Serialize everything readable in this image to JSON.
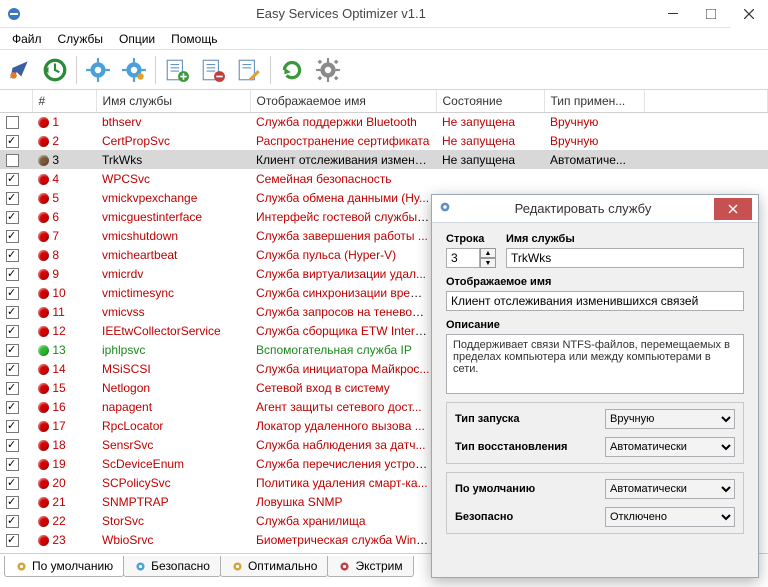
{
  "window": {
    "title": "Easy Services Optimizer v1.1"
  },
  "menu": {
    "file": "Файл",
    "services": "Службы",
    "options": "Опции",
    "help": "Помощь"
  },
  "columns": {
    "num": "#",
    "name": "Имя службы",
    "display": "Отображаемое имя",
    "state": "Состояние",
    "start": "Тип примен..."
  },
  "state": {
    "stopped": "Не запущена"
  },
  "start": {
    "manual": "Вручную",
    "auto": "Автоматиче..."
  },
  "rows": [
    {
      "n": "1",
      "chk": false,
      "dot": "red",
      "name": "bthserv",
      "disp": "Служба поддержки Bluetooth",
      "state": "stopped",
      "st": "manual",
      "cls": "redt"
    },
    {
      "n": "2",
      "chk": true,
      "dot": "red",
      "name": "CertPropSvc",
      "disp": "Распространение сертификата",
      "state": "stopped",
      "st": "manual",
      "cls": "redt"
    },
    {
      "n": "3",
      "chk": false,
      "dot": "brown",
      "name": "TrkWks",
      "disp": "Клиент отслеживания изменив...",
      "state": "stopped",
      "st": "auto",
      "cls": "blackt",
      "sel": true
    },
    {
      "n": "4",
      "chk": true,
      "dot": "red",
      "name": "WPCSvc",
      "disp": "Семейная безопасность",
      "state": "",
      "st": "",
      "cls": "redt"
    },
    {
      "n": "5",
      "chk": true,
      "dot": "red",
      "name": "vmickvpexchange",
      "disp": "Служба обмена данными (Hy...",
      "state": "",
      "st": "",
      "cls": "redt"
    },
    {
      "n": "6",
      "chk": true,
      "dot": "red",
      "name": "vmicguestinterface",
      "disp": "Интерфейс гостевой службы ...",
      "state": "",
      "st": "",
      "cls": "redt"
    },
    {
      "n": "7",
      "chk": true,
      "dot": "red",
      "name": "vmicshutdown",
      "disp": "Служба завершения работы ...",
      "state": "",
      "st": "",
      "cls": "redt"
    },
    {
      "n": "8",
      "chk": true,
      "dot": "red",
      "name": "vmicheartbeat",
      "disp": "Служба пульса (Hyper-V)",
      "state": "",
      "st": "",
      "cls": "redt"
    },
    {
      "n": "9",
      "chk": true,
      "dot": "red",
      "name": "vmicrdv",
      "disp": "Служба виртуализации удал...",
      "state": "",
      "st": "",
      "cls": "redt"
    },
    {
      "n": "10",
      "chk": true,
      "dot": "red",
      "name": "vmictimesync",
      "disp": "Служба синхронизации време...",
      "state": "",
      "st": "",
      "cls": "redt"
    },
    {
      "n": "11",
      "chk": true,
      "dot": "red",
      "name": "vmicvss",
      "disp": "Служба запросов на теневое ...",
      "state": "",
      "st": "",
      "cls": "redt"
    },
    {
      "n": "12",
      "chk": true,
      "dot": "red",
      "name": "IEEtwCollectorService",
      "disp": "Служба сборщика ETW Intern...",
      "state": "",
      "st": "",
      "cls": "redt"
    },
    {
      "n": "13",
      "chk": true,
      "dot": "green",
      "name": "iphlpsvc",
      "disp": "Вспомогательная служба IP",
      "state": "",
      "st": "",
      "cls": "greent"
    },
    {
      "n": "14",
      "chk": true,
      "dot": "red",
      "name": "MSiSCSI",
      "disp": "Служба инициатора Майкрос...",
      "state": "",
      "st": "",
      "cls": "redt"
    },
    {
      "n": "15",
      "chk": true,
      "dot": "red",
      "name": "Netlogon",
      "disp": "Сетевой вход в систему",
      "state": "",
      "st": "",
      "cls": "redt"
    },
    {
      "n": "16",
      "chk": true,
      "dot": "red",
      "name": "napagent",
      "disp": "Агент защиты сетевого дост...",
      "state": "",
      "st": "",
      "cls": "redt"
    },
    {
      "n": "17",
      "chk": true,
      "dot": "red",
      "name": "RpcLocator",
      "disp": "Локатор удаленного вызова ...",
      "state": "",
      "st": "",
      "cls": "redt"
    },
    {
      "n": "18",
      "chk": true,
      "dot": "red",
      "name": "SensrSvc",
      "disp": "Служба наблюдения за датч...",
      "state": "",
      "st": "",
      "cls": "redt"
    },
    {
      "n": "19",
      "chk": true,
      "dot": "red",
      "name": "ScDeviceEnum",
      "disp": "Служба перечисления устрой...",
      "state": "",
      "st": "",
      "cls": "redt"
    },
    {
      "n": "20",
      "chk": true,
      "dot": "red",
      "name": "SCPolicySvc",
      "disp": "Политика удаления смарт-ка...",
      "state": "",
      "st": "",
      "cls": "redt"
    },
    {
      "n": "21",
      "chk": true,
      "dot": "red",
      "name": "SNMPTRAP",
      "disp": "Ловушка SNMP",
      "state": "",
      "st": "",
      "cls": "redt"
    },
    {
      "n": "22",
      "chk": true,
      "dot": "red",
      "name": "StorSvc",
      "disp": "Служба хранилища",
      "state": "",
      "st": "",
      "cls": "redt"
    },
    {
      "n": "23",
      "chk": true,
      "dot": "red",
      "name": "WbioSrvc",
      "disp": "Биометрическая служба Wind...",
      "state": "",
      "st": "",
      "cls": "redt"
    }
  ],
  "tabs": {
    "default": "По умолчанию",
    "safe": "Безопасно",
    "optimal": "Оптимально",
    "extreme": "Экстрим"
  },
  "dlg": {
    "title": "Редактировать службу",
    "line_lbl": "Строка",
    "name_lbl": "Имя службы",
    "line_val": "3",
    "name_val": "TrkWks",
    "disp_lbl": "Отображаемое имя",
    "disp_val": "Клиент отслеживания изменившихся связей",
    "desc_lbl": "Описание",
    "desc_val": "Поддерживает связи NTFS-файлов, перемещаемых в пределах компьютера или между компьютерами в сети.",
    "start_lbl": "Тип запуска",
    "start_val": "Вручную",
    "recov_lbl": "Тип восстановления",
    "recov_val": "Автоматически",
    "default_lbl": "По умолчанию",
    "default_val": "Автоматически",
    "safe_lbl": "Безопасно",
    "safe_val": "Отключено"
  }
}
